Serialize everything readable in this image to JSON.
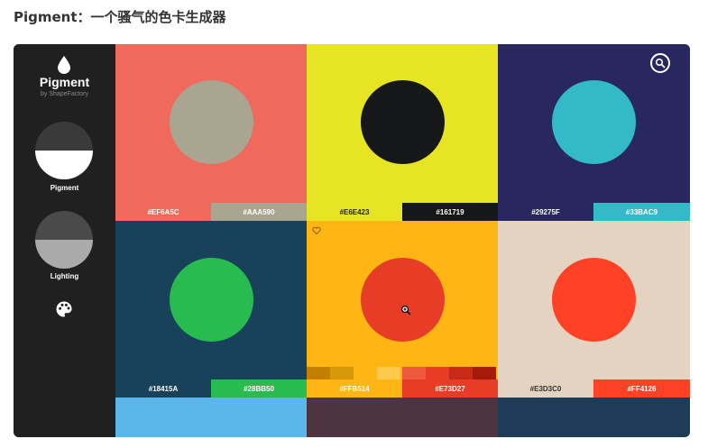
{
  "page": {
    "heading": "Pigment：一个骚气的色卡生成器"
  },
  "sidebar": {
    "logo_icon": "drop-icon",
    "app_name": "Pigment",
    "subtitle": "by ShapeFactory",
    "modes": [
      {
        "label": "Pigment",
        "top_color": "#3a3a3a",
        "bottom_color": "#ffffff"
      },
      {
        "label": "Lighting",
        "top_color": "#4a4a4a",
        "bottom_color": "#aaaaaa"
      }
    ],
    "palette_icon": "palette-icon"
  },
  "toolbar": {
    "search_icon": "search-icon"
  },
  "swatches": [
    {
      "bg": "#EF6A5C",
      "circle": "#AAA590",
      "chips": [
        "#EF6A5C",
        "#AAA590"
      ],
      "chip_text": [
        "#ffffff",
        "#ffffff"
      ]
    },
    {
      "bg": "#E6E423",
      "circle": "#161719",
      "chips": [
        "#E6E423",
        "#161719"
      ],
      "chip_text": [
        "#222222",
        "#ffffff"
      ]
    },
    {
      "bg": "#29275F",
      "circle": "#33BAC9",
      "chips": [
        "#29275F",
        "#33BAC9"
      ],
      "chip_text": [
        "#ffffff",
        "#ffffff"
      ]
    },
    {
      "bg": "#18415A",
      "circle": "#28BB50",
      "chips": [
        "#18415A",
        "#28BB50"
      ],
      "chip_text": [
        "#ffffff",
        "#ffffff"
      ]
    },
    {
      "bg": "#FFB514",
      "circle": "#E73D27",
      "chips": [
        "#FFB514",
        "#E73D27"
      ],
      "chip_text": [
        "#ffffff",
        "#ffffff"
      ],
      "selected": true
    },
    {
      "bg": "#E3D3C0",
      "circle": "#FF4126",
      "chips": [
        "#E3D3C0",
        "#FF4126"
      ],
      "chip_text": [
        "#333333",
        "#ffffff"
      ]
    }
  ],
  "selected_strip": {
    "left": [
      "#C47F00",
      "#D69A08",
      "#FFB514",
      "#FFC94A"
    ],
    "right": [
      "#EF5A3F",
      "#E73D27",
      "#C82A18",
      "#A61A0C"
    ]
  },
  "bottom_row": [
    "#5AB7EA",
    "#4E3340",
    "#1E3B58"
  ]
}
